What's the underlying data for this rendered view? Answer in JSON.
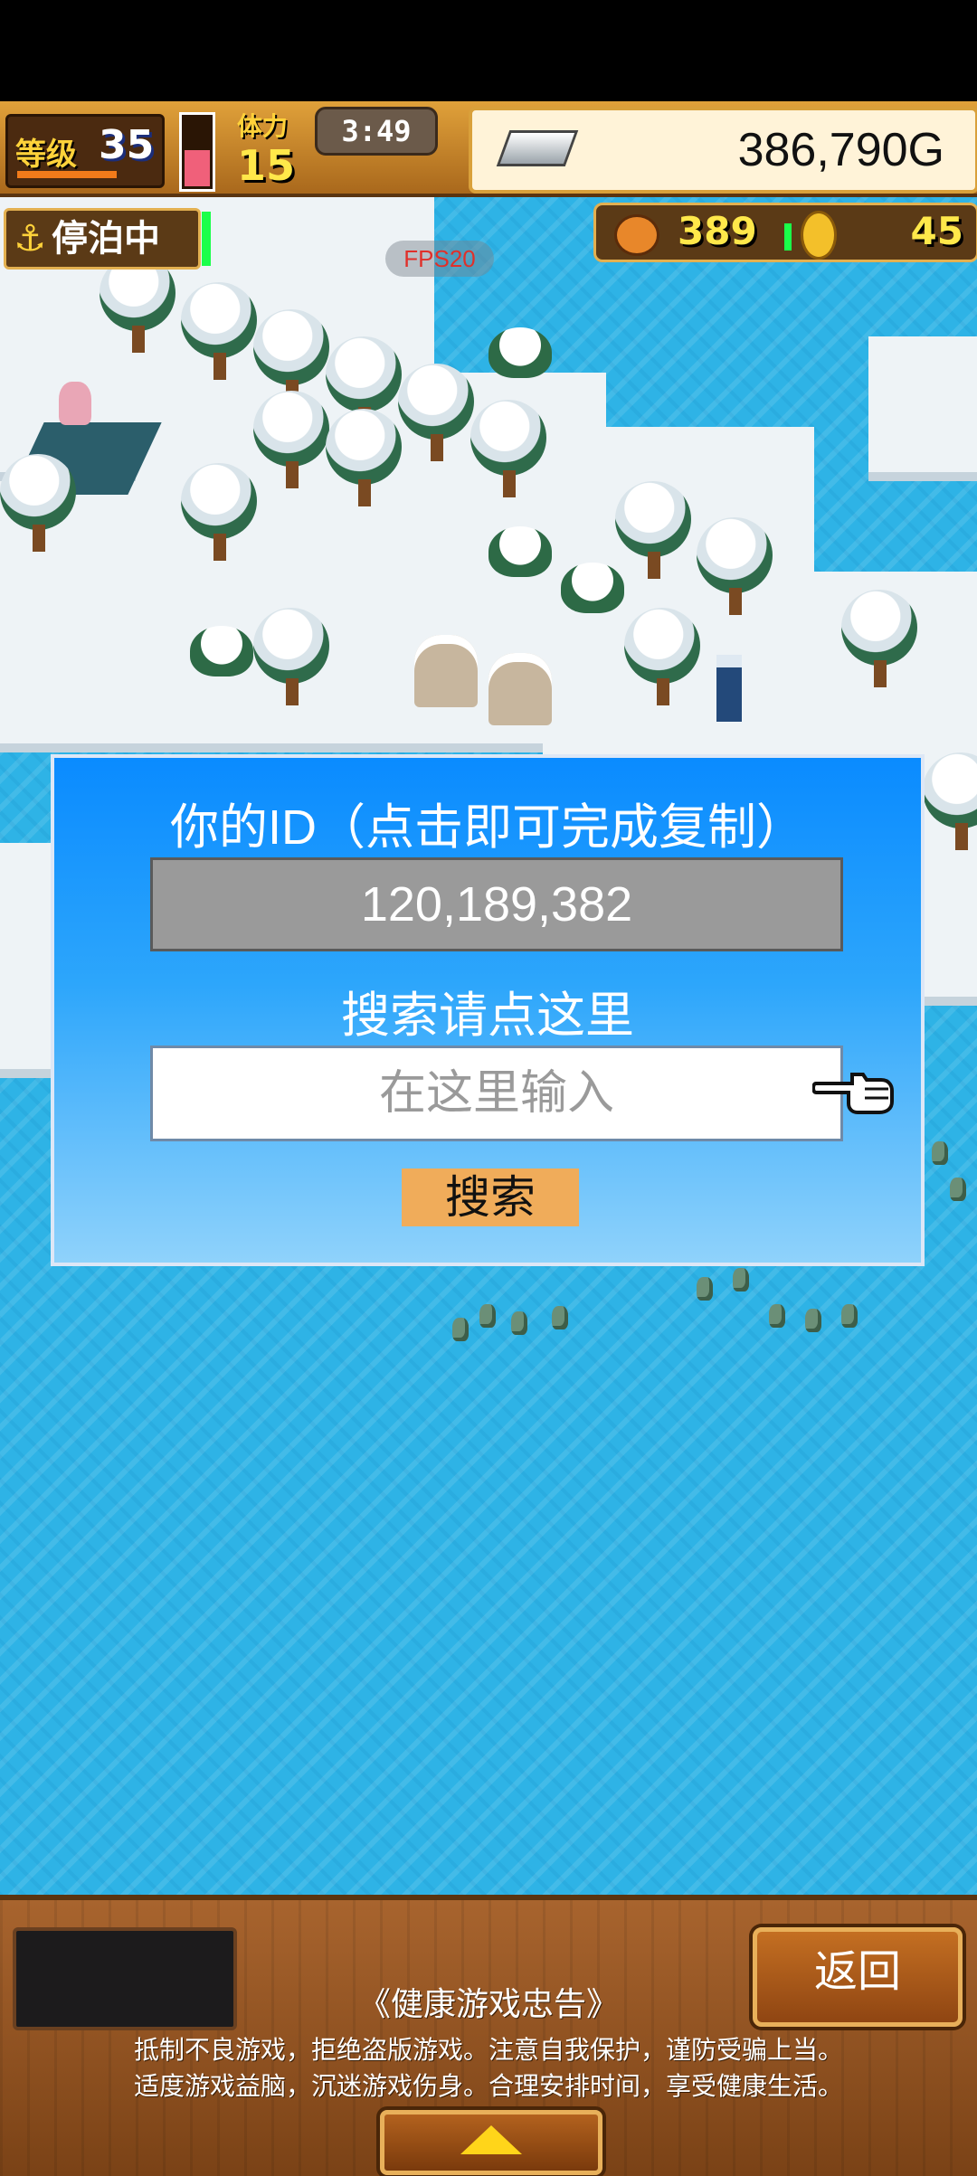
{
  "hud": {
    "level_label": "等级",
    "level": "35",
    "stamina_label": "体力",
    "stamina": "15",
    "timer": "3:49",
    "gold": "386,790G",
    "status": "停泊中",
    "resource_1": "389",
    "resource_2": "45",
    "fps": "FPS20"
  },
  "dialog": {
    "title": "你的ID（点击即可完成复制）",
    "user_id": "120,189,382",
    "search_hint": "搜索请点这里",
    "search_placeholder": "在这里输入",
    "search_button": "搜索"
  },
  "bottom": {
    "back_button": "返回",
    "advisory_title": "《健康游戏忠告》",
    "advisory_line1": "抵制不良游戏，拒绝盗版游戏。注意自我保护，谨防受骗上当。",
    "advisory_line2": "适度游戏益脑，沉迷游戏伤身。合理安排时间，享受健康生活。"
  },
  "icons": [
    "anchor-icon",
    "silver-bar-icon",
    "food-icon",
    "coin-icon",
    "pointer-hand-icon",
    "up-arrow-icon"
  ],
  "colors": {
    "dialog_top": "#0a8bff",
    "dialog_bottom": "#8fd2fb",
    "search_button": "#f0ac5a",
    "water": "#2eb3e6"
  }
}
